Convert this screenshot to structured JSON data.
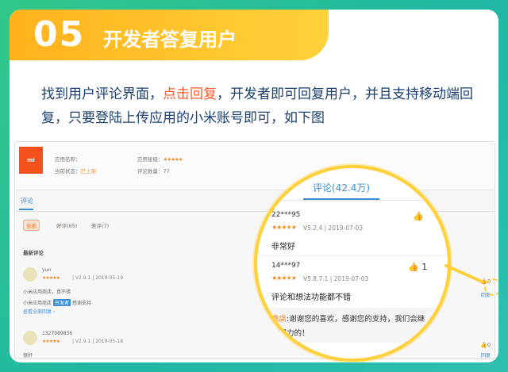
{
  "header": {
    "number": "05",
    "title": "开发者答复用户"
  },
  "intro": {
    "part1": "找到用户评论界面，",
    "highlight": "点击回复",
    "part2": "，开发者即可回复用户，并且支持移动端回复，只要登陆上传应用的小米账号即可，如下图"
  },
  "app": {
    "logo_text": "mi",
    "name_label": "应用名称：",
    "status_label": "当前状态：",
    "status_value": "已上架",
    "rating_label": "应用星级：",
    "rating_stars": "★★★★★",
    "count_label": "评论数量：",
    "count_value": "77"
  },
  "tabs": {
    "comments": "评论"
  },
  "filters": {
    "all": "全部",
    "good": "好评(65)",
    "bad": "差评(7)"
  },
  "section_title": "最新评论",
  "reviews": [
    {
      "user": "yun",
      "stars": "★★★★★",
      "meta": "| V2.9.1 | 2019-05-19",
      "text": "小米应用商店，真不错",
      "reply_prefix": "小米应用商店",
      "reply_badge": "开发者",
      "reply_text": "感谢支持",
      "more": "查看全部回复 ›",
      "likes": "0",
      "reply_label": "回复"
    },
    {
      "user": "1327989836",
      "stars": "★★★★★",
      "meta": "| V2.9.1 | 2019-05-18",
      "text": "很好",
      "likes": "0",
      "reply_label": "回复"
    }
  ],
  "magnifier": {
    "tab_label": "评论(42.4万)",
    "items": [
      {
        "user": "22***95",
        "stars": "★★★★★",
        "version_date": "V5.2.4 | 2019-07-03",
        "text": "非常好",
        "likes": ""
      },
      {
        "user": "14***97",
        "stars": "★★★★★",
        "version_date": "V5.8.7.1 | 2019-07-03",
        "text": "评论和想法功能都不错",
        "likes": "1"
      }
    ],
    "dev_reply": {
      "dev_name": "商店",
      "line1": ":谢谢您的喜欢，感谢您的支持，我们会继",
      "line2": "续努力的！"
    }
  },
  "icons": {
    "thumb": "thumb-up-icon"
  },
  "colors": {
    "accent_orange": "#ff5a2a",
    "link_blue": "#3b8ed8",
    "banner_yellow": "#ffb21c",
    "bg_green": "#32c88a"
  }
}
